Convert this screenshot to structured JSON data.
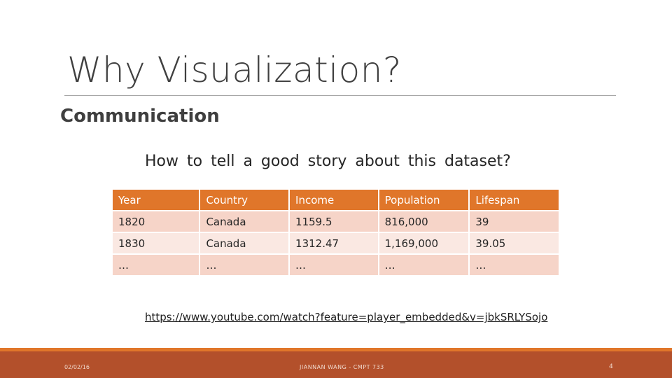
{
  "slide": {
    "title": "Why  Visualization?",
    "subtitle": "Communication",
    "question": "How to tell a good story about this dataset?",
    "link": "https://www.youtube.com/watch?feature=player_embedded&v=jbkSRLYSojo"
  },
  "table": {
    "headers": [
      "Year",
      "Country",
      "Income",
      "Population",
      "Lifespan"
    ],
    "rows": [
      [
        "1820",
        "Canada",
        "1159.5",
        "816,000",
        "39"
      ],
      [
        "1830",
        "Canada",
        "1312.47",
        "1,169,000",
        "39.05"
      ],
      [
        "…",
        "…",
        "…",
        "…",
        "…"
      ]
    ]
  },
  "footer": {
    "date": "02/02/16",
    "author": "JIANNAN WANG - CMPT 733",
    "page": "4"
  },
  "colors": {
    "header_fill": "#e0762a",
    "row_odd": "#f6d4c8",
    "row_even": "#fae8e2",
    "footer_bar": "#b3502b"
  }
}
